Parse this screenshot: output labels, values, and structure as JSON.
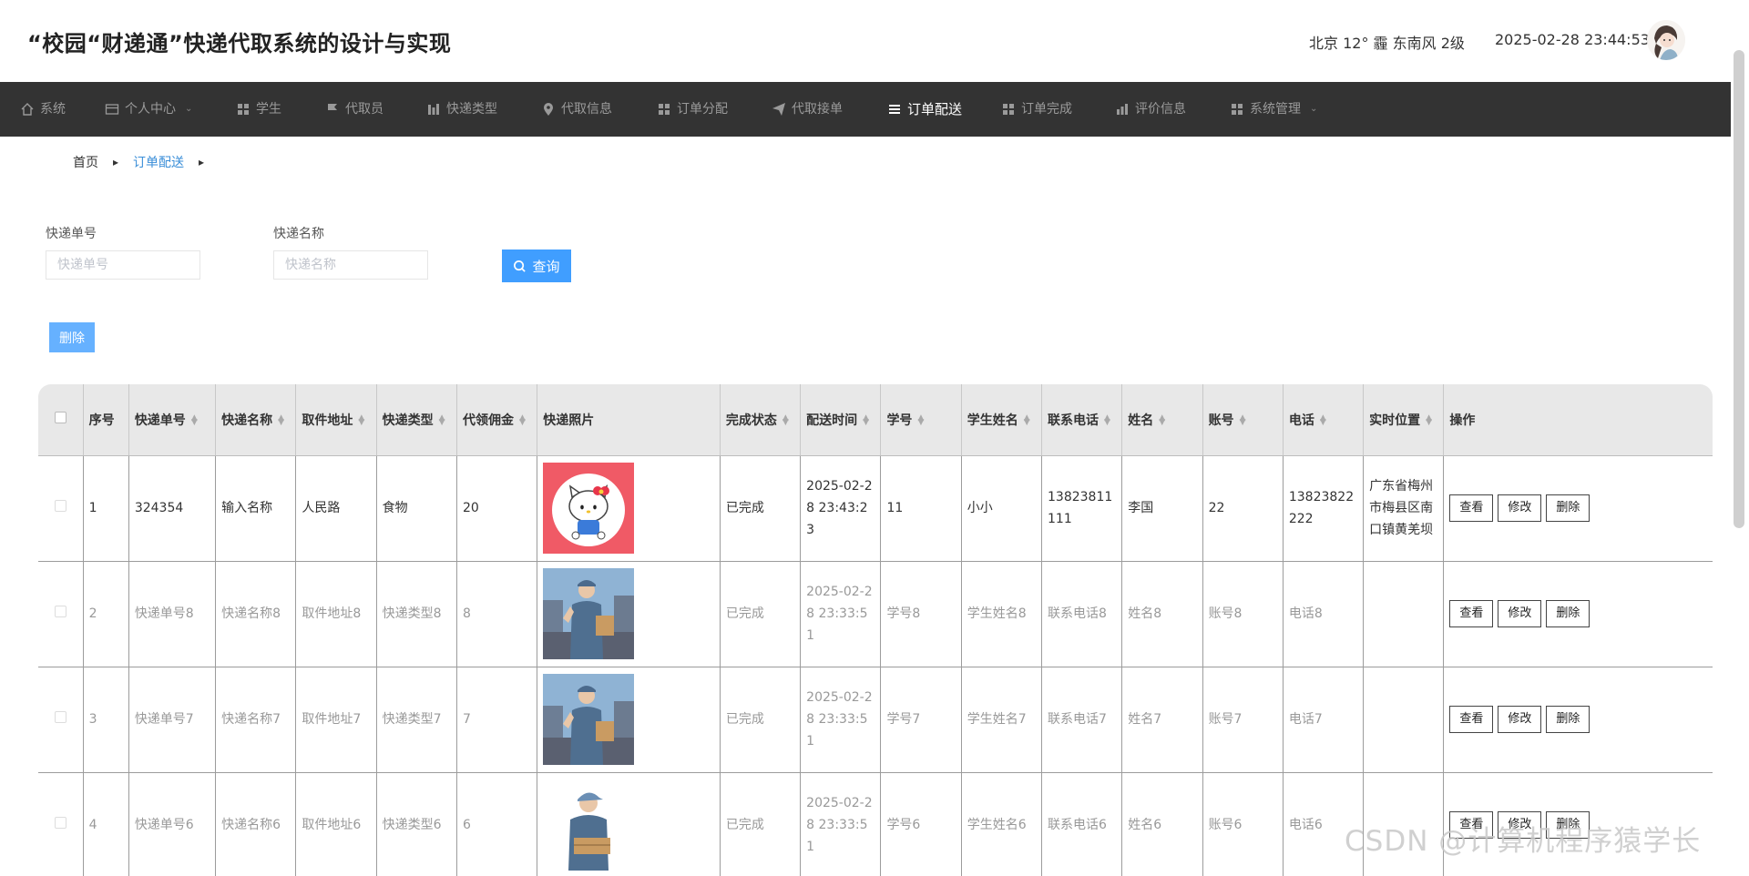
{
  "header": {
    "title": "“校园“财递通”快递代取系统的设计与实现",
    "weather": "北京  12°  霾  东南风  2级",
    "datetime": "2025-02-28 23:44:53"
  },
  "nav": [
    {
      "label": "系统",
      "icon": "home-icon"
    },
    {
      "label": "个人中心",
      "icon": "card-icon",
      "dropdown": true
    },
    {
      "label": "学生",
      "icon": "grid-icon"
    },
    {
      "label": "代取员",
      "icon": "flag-icon"
    },
    {
      "label": "快递类型",
      "icon": "bar-icon"
    },
    {
      "label": "代取信息",
      "icon": "pin-icon"
    },
    {
      "label": "订单分配",
      "icon": "grid-icon"
    },
    {
      "label": "代取接单",
      "icon": "send-icon"
    },
    {
      "label": "订单配送",
      "icon": "list-icon",
      "active": true
    },
    {
      "label": "订单完成",
      "icon": "grid-icon"
    },
    {
      "label": "评价信息",
      "icon": "chart-icon"
    },
    {
      "label": "系统管理",
      "icon": "grid-icon",
      "dropdown": true
    }
  ],
  "breadcrumb": {
    "home": "首页",
    "current": "订单配送"
  },
  "search": {
    "tracking_label": "快递单号",
    "tracking_placeholder": "快递单号",
    "name_label": "快递名称",
    "name_placeholder": "快递名称",
    "query_button": "查询"
  },
  "toolbar": {
    "delete_label": "删除"
  },
  "table": {
    "headers": [
      "序号",
      "快递单号",
      "快递名称",
      "取件地址",
      "快递类型",
      "代领佣金",
      "快递照片",
      "完成状态",
      "配送时间",
      "学号",
      "学生姓名",
      "联系电话",
      "姓名",
      "账号",
      "电话",
      "实时位置",
      "操作"
    ],
    "actions": {
      "view": "查看",
      "edit": "修改",
      "delete": "删除"
    },
    "rows": [
      {
        "idx": "1",
        "tracking": "324354",
        "name": "输入名称",
        "address": "人民路",
        "type": "食物",
        "fee": "20",
        "photo": "hello-kitty",
        "status": "已完成",
        "time": "2025-02-28 23:43:23",
        "student_no": "11",
        "student_name": "小小",
        "contact": "13823811111",
        "courier": "李国",
        "account": "22",
        "phone": "13823822222",
        "location": "广东省梅州市梅县区南口镇黄羌坝"
      },
      {
        "idx": "2",
        "tracking": "快递单号8",
        "name": "快递名称8",
        "address": "取件地址8",
        "type": "快递类型8",
        "fee": "8",
        "photo": "courier",
        "status": "已完成",
        "time": "2025-02-28 23:33:51",
        "student_no": "学号8",
        "student_name": "学生姓名8",
        "contact": "联系电话8",
        "courier": "姓名8",
        "account": "账号8",
        "phone": "电话8",
        "location": ""
      },
      {
        "idx": "3",
        "tracking": "快递单号7",
        "name": "快递名称7",
        "address": "取件地址7",
        "type": "快递类型7",
        "fee": "7",
        "photo": "courier",
        "status": "已完成",
        "time": "2025-02-28 23:33:51",
        "student_no": "学号7",
        "student_name": "学生姓名7",
        "contact": "联系电话7",
        "courier": "姓名7",
        "account": "账号7",
        "phone": "电话7",
        "location": ""
      },
      {
        "idx": "4",
        "tracking": "快递单号6",
        "name": "快递名称6",
        "address": "取件地址6",
        "type": "快递类型6",
        "fee": "6",
        "photo": "courier-cap",
        "status": "已完成",
        "time": "2025-02-28 23:33:51",
        "student_no": "学号6",
        "student_name": "学生姓名6",
        "contact": "联系电话6",
        "courier": "姓名6",
        "account": "账号6",
        "phone": "电话6",
        "location": ""
      }
    ]
  },
  "watermark": "CSDN @计算机程序猿学长",
  "colors": {
    "nav_bg": "#333333",
    "primary": "#409eff",
    "header_row": "#e8e8e8"
  }
}
